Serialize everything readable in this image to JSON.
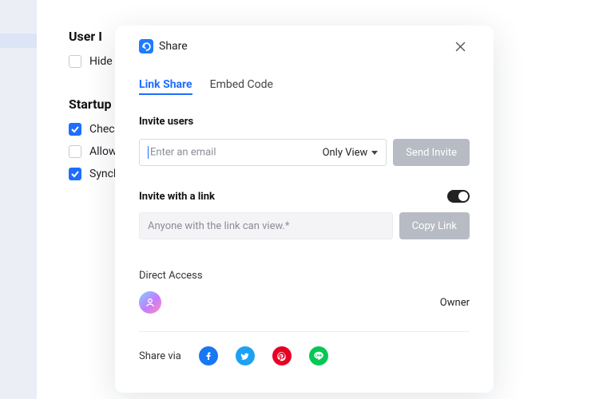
{
  "background": {
    "heading1": "User I",
    "hide_label": "Hide t",
    "heading2": "Startup",
    "rows": [
      {
        "label": "Check",
        "checked": true
      },
      {
        "label": "Allow",
        "checked": false
      },
      {
        "label": "Synch",
        "checked": true
      }
    ]
  },
  "modal": {
    "app_icon": "edraw-icon",
    "title": "Share",
    "tabs": {
      "link_share": "Link Share",
      "embed_code": "Embed Code"
    },
    "invite_users_label": "Invite users",
    "email_placeholder": "Enter an email",
    "permission_label": "Only View",
    "send_invite_label": "Send Invite",
    "invite_link_label": "Invite with a link",
    "toggle_on": true,
    "link_placeholder": "Anyone with the link can view.*",
    "copy_link_label": "Copy Link",
    "direct_access_label": "Direct Access",
    "owner_role": "Owner",
    "share_via_label": "Share via",
    "socials": {
      "facebook": "facebook-icon",
      "twitter": "twitter-icon",
      "pinterest": "pinterest-icon",
      "line": "line-icon"
    }
  }
}
